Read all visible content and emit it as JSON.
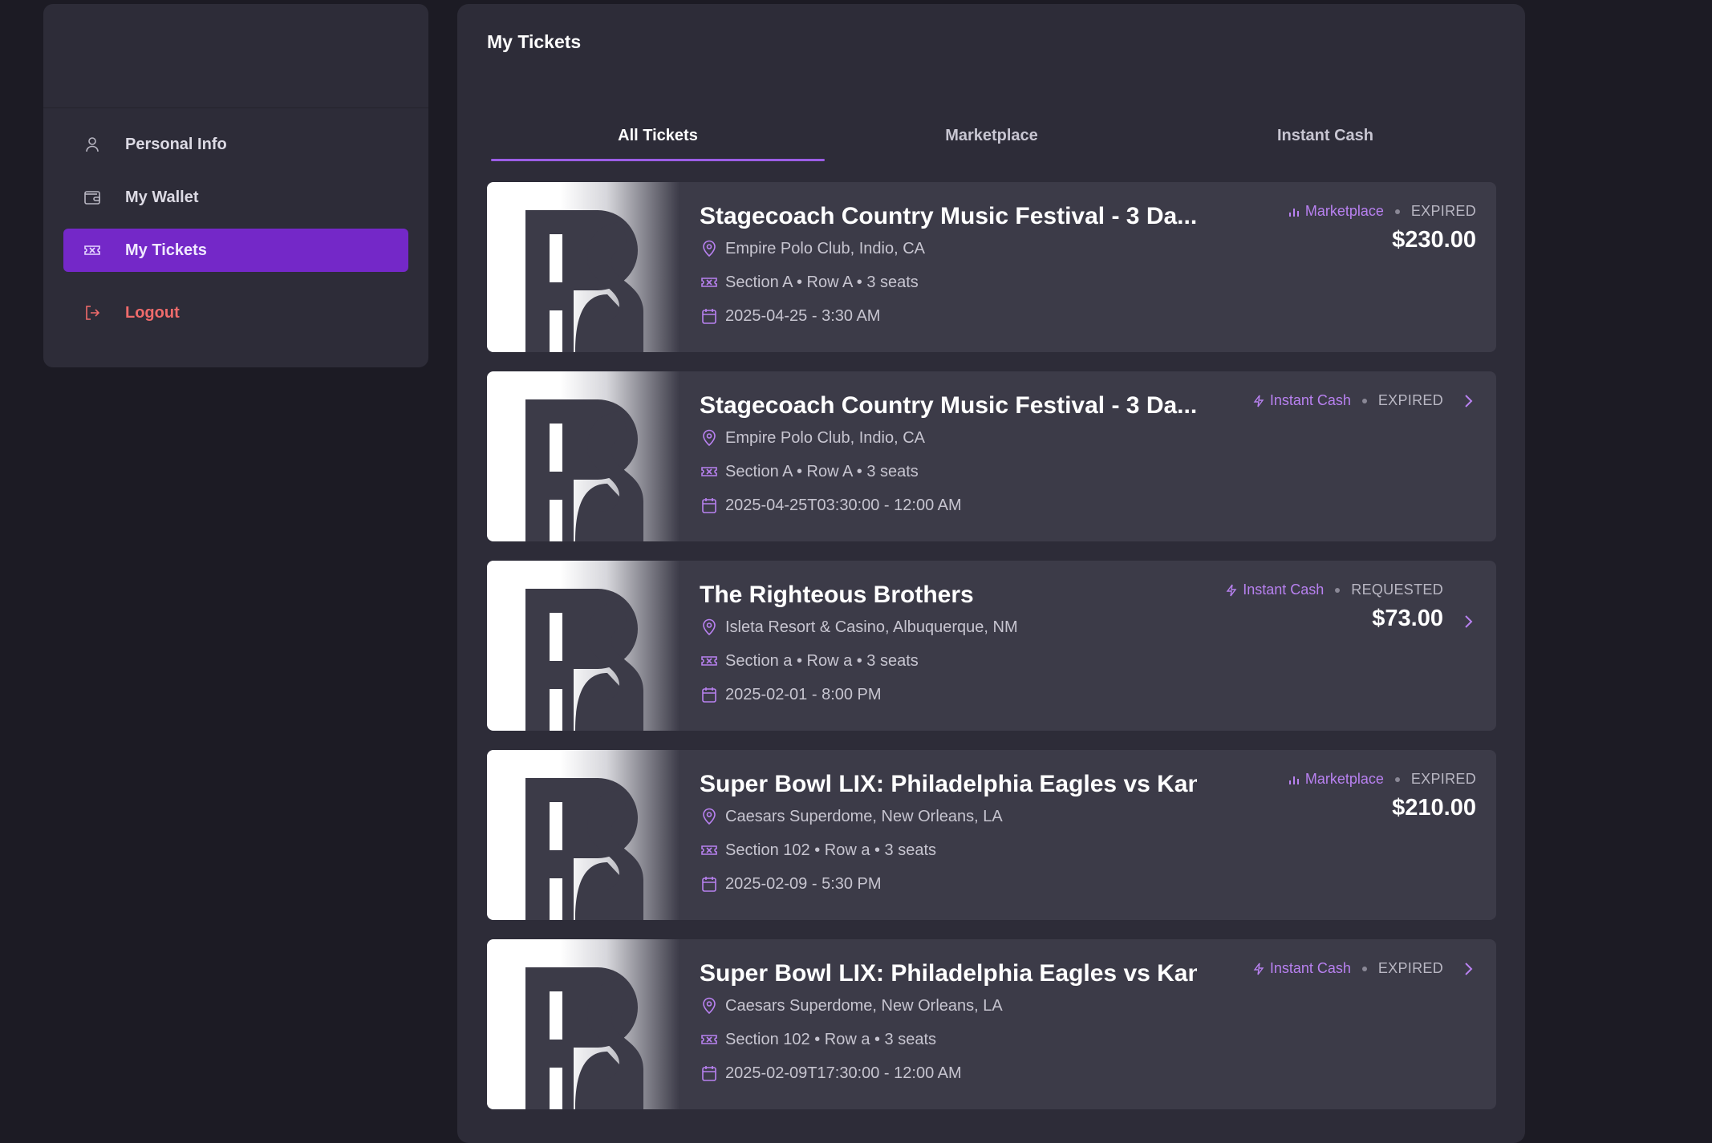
{
  "sidebar": {
    "items": [
      {
        "label": "Personal Info",
        "icon": "user-icon"
      },
      {
        "label": "My Wallet",
        "icon": "wallet-icon"
      },
      {
        "label": "My Tickets",
        "icon": "ticket-icon",
        "active": true
      },
      {
        "label": "Logout",
        "icon": "logout-icon"
      }
    ]
  },
  "main": {
    "title": "My Tickets",
    "tabs": [
      {
        "label": "All Tickets",
        "active": true
      },
      {
        "label": "Marketplace"
      },
      {
        "label": "Instant Cash"
      }
    ],
    "tickets": [
      {
        "title": "Stagecoach Country Music Festival - 3 Da...",
        "venue": "Empire Polo Club, Indio, CA",
        "seats": "Section A • Row A • 3 seats",
        "date": "2025-04-25 - 3:30 AM",
        "source": "Marketplace",
        "status": "EXPIRED",
        "price": "$230.00"
      },
      {
        "title": "Stagecoach Country Music Festival - 3 Da...",
        "venue": "Empire Polo Club, Indio, CA",
        "seats": "Section A • Row A • 3 seats",
        "date": "2025-04-25T03:30:00 - 12:00 AM",
        "source": "Instant Cash",
        "status": "EXPIRED",
        "price": ""
      },
      {
        "title": "The Righteous Brothers",
        "venue": "Isleta Resort & Casino, Albuquerque, NM",
        "seats": "Section a • Row a • 3 seats",
        "date": "2025-02-01 - 8:00 PM",
        "source": "Instant Cash",
        "status": "REQUESTED",
        "price": "$73.00"
      },
      {
        "title": "Super Bowl LIX: Philadelphia Eagles vs Kan...",
        "venue": "Caesars Superdome, New Orleans, LA",
        "seats": "Section 102 • Row a • 3 seats",
        "date": "2025-02-09 - 5:30 PM",
        "source": "Marketplace",
        "status": "EXPIRED",
        "price": "$210.00"
      },
      {
        "title": "Super Bowl LIX: Philadelphia Eagles vs Kan...",
        "venue": "Caesars Superdome, New Orleans, LA",
        "seats": "Section 102 • Row a • 3 seats",
        "date": "2025-02-09T17:30:00 - 12:00 AM",
        "source": "Instant Cash",
        "status": "EXPIRED",
        "price": ""
      }
    ]
  },
  "colors": {
    "accent": "#7428c8",
    "accent_text": "#b881f0",
    "logout": "#ef6b6b",
    "card": "#3c3b48",
    "panel": "#2d2c38",
    "background": "#1c1b24"
  }
}
